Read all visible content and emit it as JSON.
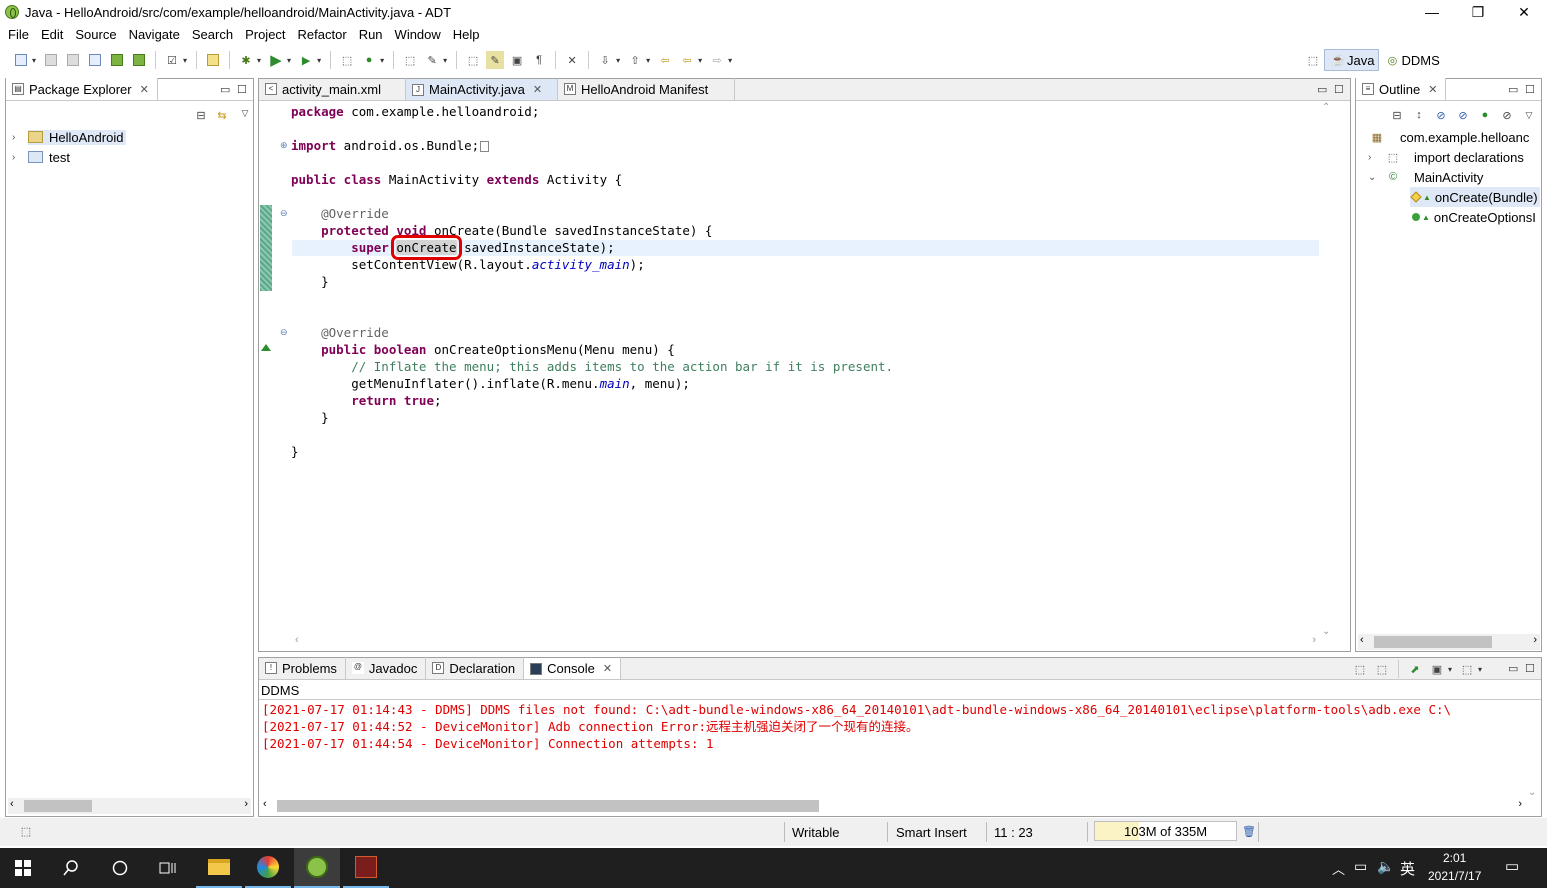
{
  "window": {
    "title": "Java - HelloAndroid/src/com/example/helloandroid/MainActivity.java - ADT",
    "min": "—",
    "restore": "❐",
    "close": "✕"
  },
  "menu": [
    "File",
    "Edit",
    "Source",
    "Navigate",
    "Search",
    "Project",
    "Refactor",
    "Run",
    "Window",
    "Help"
  ],
  "perspectives": {
    "java": "Java",
    "ddms": "DDMS"
  },
  "package_explorer": {
    "tab": "Package Explorer",
    "items": [
      "HelloAndroid",
      "test"
    ]
  },
  "editor": {
    "tabs": [
      "activity_main.xml",
      "MainActivity.java",
      "HelloAndroid Manifest"
    ],
    "lines": {
      "l1a": "package",
      "l1b": " com.example.helloandroid;",
      "l2a": "import",
      "l2b": " android.os.Bundle;",
      "l3a": "public class",
      "l3b": " MainActivity ",
      "l3c": "extends",
      "l3d": " Activity {",
      "l4": "    @Override",
      "l5a": "    protected void",
      "l5b": " onCreate(Bundle savedInstanceState) {",
      "l6a": "        super",
      "l6b": ".",
      "l6c": "onCreate",
      "l6d": "(savedInstanceState);",
      "l7a": "        setContentView(R.layout.",
      "l7b": "activity_main",
      "l7c": ");",
      "l8": "    }",
      "l9": "    @Override",
      "l10a": "    public boolean",
      "l10b": " onCreateOptionsMenu(Menu menu) {",
      "l11": "        // Inflate the menu; this adds items to the action bar if it is present.",
      "l12a": "        getMenuInflater().inflate(R.menu.",
      "l12b": "main",
      "l12c": ", menu);",
      "l13a": "        return true",
      "l13b": ";",
      "l14": "    }",
      "l15": "}"
    }
  },
  "outline": {
    "tab": "Outline",
    "items": [
      "com.example.helloanc",
      "import declarations",
      "MainActivity",
      "onCreate(Bundle)",
      "onCreateOptionsI"
    ]
  },
  "bottom": {
    "tabs": [
      "Problems",
      "Javadoc",
      "Declaration",
      "Console"
    ],
    "console_name": "DDMS",
    "lines": [
      "[2021-07-17 01:14:43 - DDMS] DDMS files not found: C:\\adt-bundle-windows-x86_64_20140101\\adt-bundle-windows-x86_64_20140101\\eclipse\\platform-tools\\adb.exe C:\\",
      "[2021-07-17 01:44:52 - DeviceMonitor] Adb connection Error:远程主机强迫关闭了一个现有的连接。",
      "[2021-07-17 01:44:54 - DeviceMonitor] Connection attempts: 1"
    ]
  },
  "status": {
    "writable": "Writable",
    "insert": "Smart Insert",
    "position": "11 : 23",
    "memory": "103M of 335M"
  },
  "taskbar": {
    "time": "2:01",
    "date": "2021/7/17",
    "ime": "英"
  },
  "colors": {
    "highlight_box": "#e00000",
    "console_error": "#e00000",
    "keyword": "#7f0055"
  }
}
